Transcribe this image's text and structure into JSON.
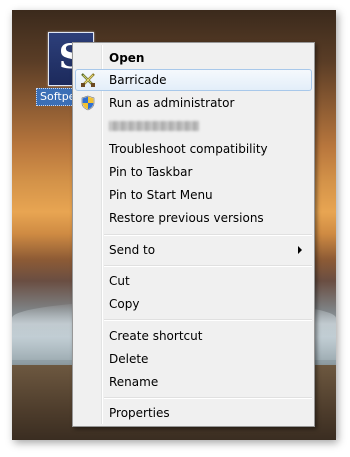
{
  "desktop": {
    "icon": {
      "glyph": "S",
      "label": "Softpedia"
    }
  },
  "context_menu": {
    "items": [
      {
        "label": "Open",
        "bold": true
      },
      {
        "label": "Barricade",
        "icon": "barricade-icon",
        "highlighted": true
      },
      {
        "label": "Run as administrator",
        "icon": "uac-shield-icon"
      },
      {
        "label": "",
        "obscured": true
      },
      {
        "label": "Troubleshoot compatibility"
      },
      {
        "label": "Pin to Taskbar"
      },
      {
        "label": "Pin to Start Menu"
      },
      {
        "label": "Restore previous versions"
      },
      {
        "label": "Send to",
        "submenu": true
      },
      {
        "label": "Cut"
      },
      {
        "label": "Copy"
      },
      {
        "label": "Create shortcut"
      },
      {
        "label": "Delete"
      },
      {
        "label": "Rename"
      },
      {
        "label": "Properties"
      }
    ]
  },
  "colors": {
    "menu_background": "#f0f0f0",
    "highlight_border": "#a8c8ea",
    "icon_tile": "#1c2a5c",
    "selection_label": "#3b6fb6"
  }
}
